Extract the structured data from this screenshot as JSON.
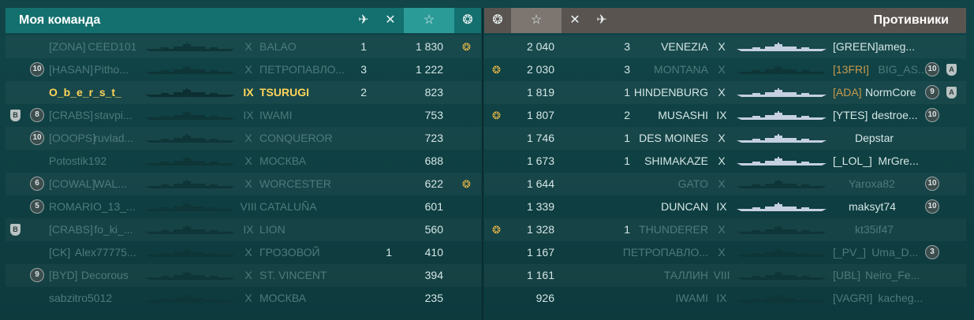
{
  "header": {
    "my_team": "Моя команда",
    "enemies": "Противники",
    "icons": {
      "plane": "plane-kills-icon",
      "hammer": "ships-destroyed-icon",
      "star": "base-xp-star-icon",
      "wreath": "medal-wreath-icon"
    }
  },
  "colors": {
    "my_header": "#13706f",
    "enemy_header": "#5a5450",
    "highlight": "#ffd45a",
    "dim": "#4e7a7b",
    "bright": "#d5e6e6"
  },
  "my_team": [
    {
      "clan": "[ZONA]",
      "name": "CEED101",
      "tier": "X",
      "ship": "BALAO",
      "planes": "1",
      "kills": "",
      "xp": "1 830",
      "badge": "",
      "rank": "",
      "medal": true,
      "dim": true
    },
    {
      "clan": "[HASAN]",
      "name": "Pitho...",
      "tier": "X",
      "ship": "ПЕТРОПАВЛО...",
      "planes": "3",
      "kills": "",
      "xp": "1 222",
      "badge": "10",
      "rank": "",
      "medal": false,
      "dim": true
    },
    {
      "clan": "",
      "name": "O_b_e_r_s_t_",
      "tier": "IX",
      "ship": "TSURUGI",
      "planes": "2",
      "kills": "",
      "xp": "823",
      "badge": "",
      "rank": "",
      "medal": false,
      "dim": false,
      "highlight": true
    },
    {
      "clan": "[CRABS]",
      "name": "stavpi...",
      "tier": "IX",
      "ship": "IWAMI",
      "planes": "",
      "kills": "",
      "xp": "753",
      "badge": "8",
      "rank": "B",
      "medal": false,
      "dim": true
    },
    {
      "clan": "[OOOPS]",
      "name": "ruvlad...",
      "tier": "X",
      "ship": "CONQUEROR",
      "planes": "",
      "kills": "",
      "xp": "723",
      "badge": "10",
      "rank": "",
      "medal": false,
      "dim": true
    },
    {
      "clan": "",
      "name": "Potostik192",
      "tier": "X",
      "ship": "МОСКВА",
      "planes": "",
      "kills": "",
      "xp": "688",
      "badge": "",
      "rank": "",
      "medal": false,
      "dim": true
    },
    {
      "clan": "[COWAL]",
      "name": "WAL...",
      "tier": "X",
      "ship": "WORCESTER",
      "planes": "",
      "kills": "",
      "xp": "622",
      "badge": "6",
      "rank": "",
      "medal": true,
      "dim": true
    },
    {
      "clan": "",
      "name": "ROMARIO_13_...",
      "tier": "VIII",
      "ship": "CATALUÑA",
      "planes": "",
      "kills": "",
      "xp": "601",
      "badge": "5",
      "rank": "",
      "medal": false,
      "dim": true
    },
    {
      "clan": "[CRABS]",
      "name": "fo_ki_...",
      "tier": "IX",
      "ship": "LION",
      "planes": "",
      "kills": "",
      "xp": "560",
      "badge": "",
      "rank": "B",
      "medal": false,
      "dim": true
    },
    {
      "clan": "[CK]",
      "name": "Alex77775...",
      "tier": "X",
      "ship": "ГРОЗОВОЙ",
      "planes": "",
      "kills": "1",
      "xp": "410",
      "badge": "",
      "rank": "",
      "medal": false,
      "dim": true
    },
    {
      "clan": "[BYD]",
      "name": "Decorous",
      "tier": "X",
      "ship": "ST. VINCENT",
      "planes": "",
      "kills": "",
      "xp": "394",
      "badge": "9",
      "rank": "",
      "medal": false,
      "dim": true
    },
    {
      "clan": "",
      "name": "sabzitro5012",
      "tier": "X",
      "ship": "МОСКВА",
      "planes": "",
      "kills": "",
      "xp": "235",
      "badge": "",
      "rank": "",
      "medal": false,
      "dim": true
    }
  ],
  "enemies": [
    {
      "medal": false,
      "xp": "2 040",
      "planes": "3",
      "ship": "VENEZIA",
      "tier": "X",
      "clan": "[GREEN]",
      "name": "ameg...",
      "badge": "",
      "rank": "",
      "dim": false
    },
    {
      "medal": true,
      "xp": "2 030",
      "planes": "3",
      "ship": "MONTANA",
      "tier": "X",
      "clan": "[13FRI]",
      "name": "BIG_AS...",
      "badge": "10",
      "rank": "A",
      "dim": true
    },
    {
      "medal": false,
      "xp": "1 819",
      "planes": "1",
      "ship": "HINDENBURG",
      "tier": "X",
      "clan": "[ADA]",
      "name": "NormCore",
      "badge": "9",
      "rank": "A",
      "dim": false
    },
    {
      "medal": true,
      "xp": "1 807",
      "planes": "2",
      "ship": "MUSASHI",
      "tier": "IX",
      "clan": "[YTES]",
      "name": "destroe...",
      "badge": "10",
      "rank": "",
      "dim": false
    },
    {
      "medal": false,
      "xp": "1 746",
      "planes": "1",
      "ship": "DES MOINES",
      "tier": "X",
      "clan": "",
      "name": "Depstar",
      "badge": "",
      "rank": "",
      "dim": false
    },
    {
      "medal": false,
      "xp": "1 673",
      "planes": "1",
      "ship": "SHIMAKAZE",
      "tier": "X",
      "clan": "[_LOL_]",
      "name": "MrGre...",
      "badge": "",
      "rank": "",
      "dim": false
    },
    {
      "medal": false,
      "xp": "1 644",
      "planes": "",
      "ship": "GATO",
      "tier": "X",
      "clan": "",
      "name": "Yaroxa82",
      "badge": "10",
      "rank": "",
      "dim": true
    },
    {
      "medal": false,
      "xp": "1 339",
      "planes": "",
      "ship": "DUNCAN",
      "tier": "IX",
      "clan": "",
      "name": "maksyt74",
      "badge": "10",
      "rank": "",
      "dim": false
    },
    {
      "medal": true,
      "xp": "1 328",
      "planes": "1",
      "ship": "THUNDERER",
      "tier": "X",
      "clan": "",
      "name": "kt35if47",
      "badge": "",
      "rank": "",
      "dim": true
    },
    {
      "medal": false,
      "xp": "1 167",
      "planes": "",
      "ship": "ПЕТРОПАВЛО...",
      "tier": "X",
      "clan": "[_PV_]",
      "name": "Uma_D...",
      "badge": "3",
      "rank": "",
      "dim": true
    },
    {
      "medal": false,
      "xp": "1 161",
      "planes": "",
      "ship": "ТАЛЛИН",
      "tier": "VIII",
      "clan": "[UBL]",
      "name": "Neiro_Fe...",
      "badge": "",
      "rank": "",
      "dim": true
    },
    {
      "medal": false,
      "xp": "926",
      "planes": "",
      "ship": "IWAMI",
      "tier": "IX",
      "clan": "[VAGRI]",
      "name": "kacheg...",
      "badge": "",
      "rank": "",
      "dim": true
    }
  ]
}
